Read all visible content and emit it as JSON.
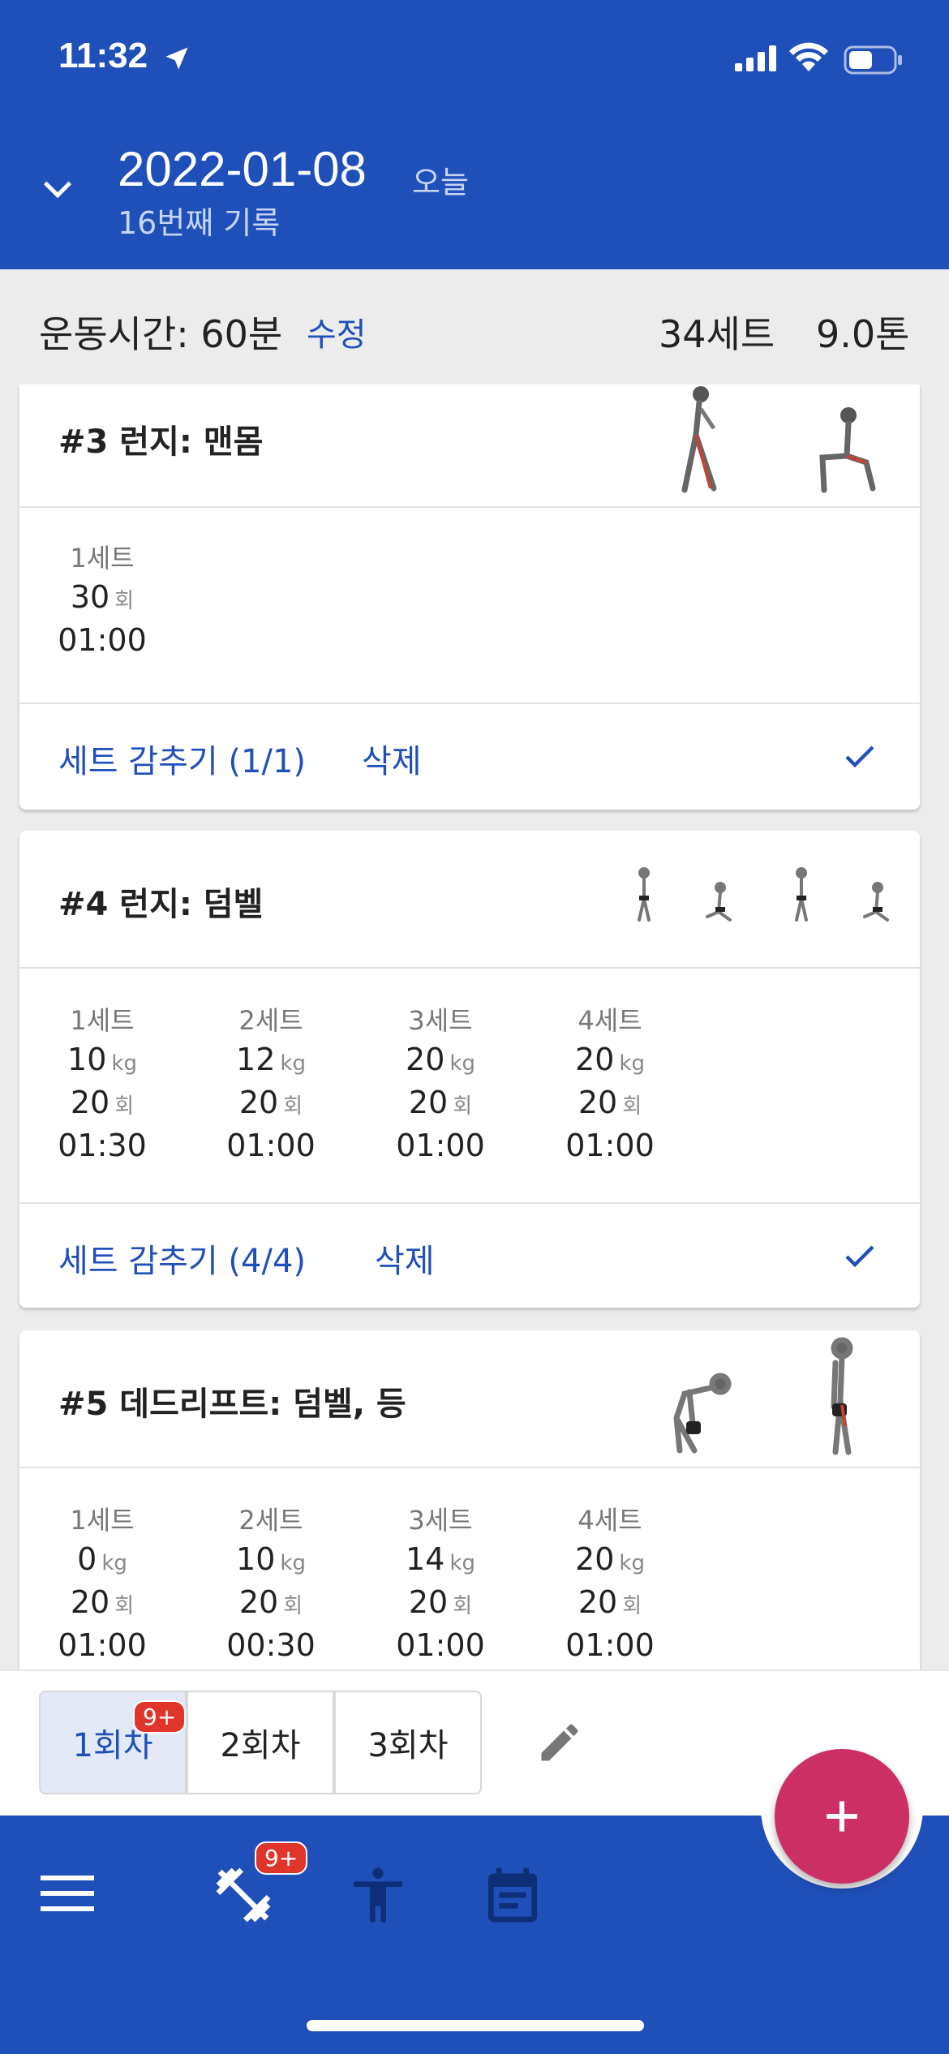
{
  "status_bar": {
    "time": "11:32"
  },
  "header": {
    "date": "2022-01-08",
    "today": "오늘",
    "record_count": "16번째 기록"
  },
  "summary": {
    "duration": "운동시간: 60분",
    "edit": "수정",
    "sets": "34세트",
    "tons": "9.0톤"
  },
  "units": {
    "kg": "kg",
    "reps": "회"
  },
  "exercises": [
    {
      "title": "#3 런지: 맨몸",
      "sets": [
        {
          "label": "1세트",
          "reps": "30",
          "time": "01:00"
        }
      ],
      "hide_label": "세트 감추기 (1/1)",
      "delete_label": "삭제"
    },
    {
      "title": "#4 런지: 덤벨",
      "sets": [
        {
          "label": "1세트",
          "weight": "10",
          "reps": "20",
          "time": "01:30"
        },
        {
          "label": "2세트",
          "weight": "12",
          "reps": "20",
          "time": "01:00"
        },
        {
          "label": "3세트",
          "weight": "20",
          "reps": "20",
          "time": "01:00"
        },
        {
          "label": "4세트",
          "weight": "20",
          "reps": "20",
          "time": "01:00"
        }
      ],
      "hide_label": "세트 감추기 (4/4)",
      "delete_label": "삭제"
    },
    {
      "title": "#5 데드리프트: 덤벨, 등",
      "sets": [
        {
          "label": "1세트",
          "weight": "0",
          "reps": "20",
          "time": "01:00"
        },
        {
          "label": "2세트",
          "weight": "10",
          "reps": "20",
          "time": "00:30"
        },
        {
          "label": "3세트",
          "weight": "14",
          "reps": "20",
          "time": "01:00"
        },
        {
          "label": "4세트",
          "weight": "20",
          "reps": "20",
          "time": "01:00"
        }
      ]
    }
  ],
  "sessions": {
    "tabs": [
      "1회차",
      "2회차",
      "3회차"
    ],
    "selected": "1회차",
    "badge": "9+"
  },
  "nav": {
    "badge": "9+",
    "items": [
      "menu-icon",
      "dumbbell-icon",
      "body-icon",
      "calendar-icon"
    ]
  },
  "fab_icon": "plus-icon",
  "colors": {
    "primary": "#1f4fb9",
    "accent": "#cc2f63",
    "badge": "#e0352b"
  }
}
